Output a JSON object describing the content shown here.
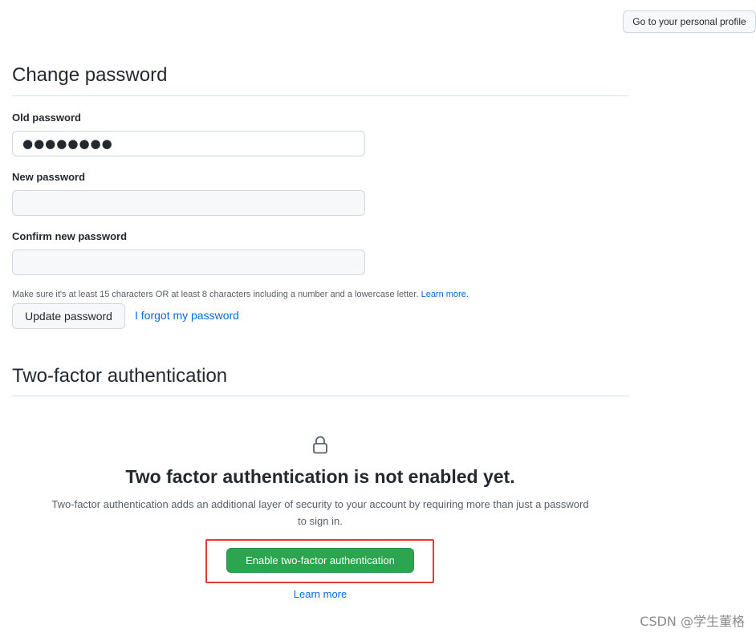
{
  "header": {
    "profile_button": "Go to your personal profile"
  },
  "change_password": {
    "title": "Change password",
    "old_label": "Old password",
    "old_value": "●●●●●●●●",
    "new_label": "New password",
    "new_value": "",
    "confirm_label": "Confirm new password",
    "confirm_value": "",
    "note": "Make sure it's at least 15 characters OR at least 8 characters including a number and a lowercase letter.",
    "note_link": "Learn more.",
    "update_button": "Update password",
    "forgot_link": "I forgot my password"
  },
  "two_factor": {
    "title": "Two-factor authentication",
    "icon": "lock-icon",
    "heading": "Two factor authentication is not enabled yet.",
    "description": "Two-factor authentication adds an additional layer of security to your account by requiring more than just a password to sign in.",
    "enable_button": "Enable two-factor authentication",
    "learn_more": "Learn more"
  },
  "watermark": "CSDN @学生董格",
  "colors": {
    "primary_button": "#2da44e",
    "link": "#0969da",
    "highlight_box": "#e53935"
  }
}
